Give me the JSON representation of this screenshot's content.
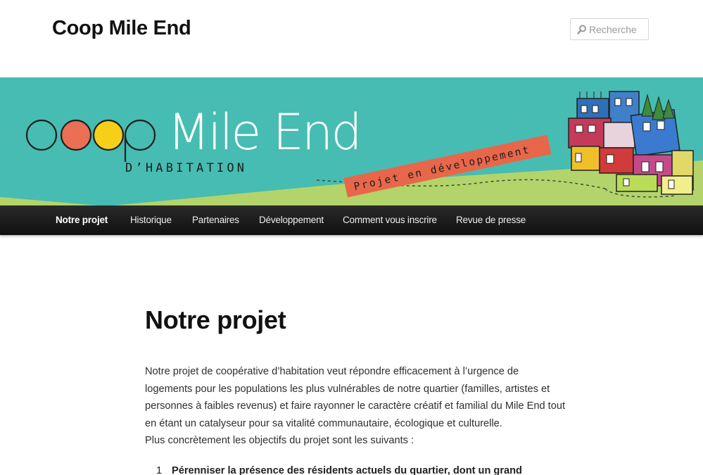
{
  "header": {
    "site_title": "Coop Mile End",
    "search_placeholder": "Recherche"
  },
  "banner": {
    "logo_word1": "coop",
    "logo_word2": "Mile End",
    "logo_sub": "D’HABITATION",
    "ribbon_text": "Projet en développement",
    "colors": {
      "teal": "#47bcb2",
      "green": "#b3d46b",
      "ribbon": "#e8674a",
      "logo_orange": "#ea6f55",
      "logo_yellow": "#f6cf18"
    }
  },
  "nav": {
    "items": [
      {
        "label": "Notre projet",
        "active": true
      },
      {
        "label": "Historique"
      },
      {
        "label": "Partenaires"
      },
      {
        "label": "Développement"
      },
      {
        "label": "Comment vous inscrire"
      },
      {
        "label": "Revue de presse"
      }
    ]
  },
  "main": {
    "title": "Notre projet",
    "intro": "Notre projet de coopérative d’habitation veut répondre efficacement à l’urgence de logements pour les  populations les plus vulnérables de notre quartier (familles, artistes et personnes à faibles revenus) et faire rayonner le caractère créatif et familial du Mile End tout en étant un catalyseur pour sa vitalité communautaire, écologique et culturelle.",
    "objectives_lead": "Plus concrètement les objectifs du projet sont les suivants :",
    "list": [
      {
        "num": "1",
        "text": "Pérenniser la présence des résidents actuels du quartier, dont un grand"
      }
    ]
  }
}
